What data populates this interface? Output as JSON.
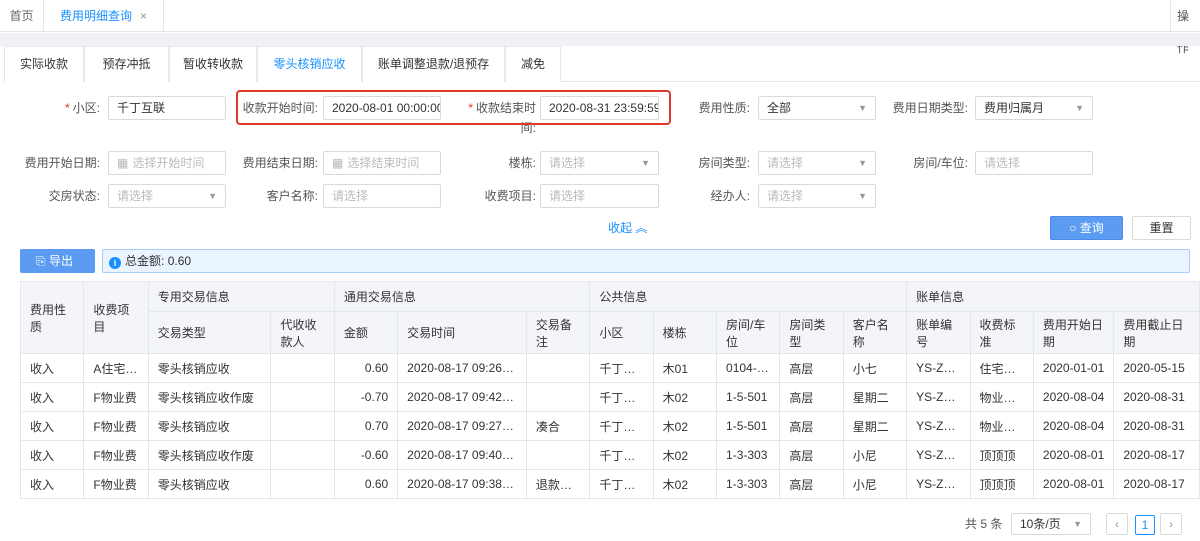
{
  "top_tabs": {
    "home": "首页",
    "active": "费用明细查询",
    "close": "×",
    "ops": "操作"
  },
  "sub_tabs": [
    "实际收款",
    "预存冲抵",
    "暂收转收款",
    "零头核销应收",
    "账单调整退款/退预存",
    "减免"
  ],
  "filters": {
    "community_label": "小区:",
    "community_value": "千丁互联",
    "pay_start_label": "收款开始时间:",
    "pay_start_value": "2020-08-01 00:00:00",
    "pay_end_label": "收款结束时",
    "pay_end_label2": "间:",
    "pay_end_value": "2020-08-31 23:59:59",
    "fee_nature_label": "费用性质:",
    "fee_nature_value": "全部",
    "fee_date_type_label": "费用日期类型:",
    "fee_date_type_value": "费用归属月",
    "fee_start_label": "费用开始日期:",
    "fee_start_placeholder": "选择开始时间",
    "fee_end_label": "费用结束日期:",
    "fee_end_placeholder": "选择结束时间",
    "building_label": "楼栋:",
    "building_placeholder": "请选择",
    "room_type_label": "房间类型:",
    "room_type_placeholder": "请选择",
    "room_label": "房间/车位:",
    "room_placeholder": "请选择",
    "handover_label": "交房状态:",
    "handover_placeholder": "请选择",
    "customer_label": "客户名称:",
    "customer_placeholder": "请选择",
    "item_label": "收费项目:",
    "item_placeholder": "请选择",
    "operator_label": "经办人:",
    "operator_placeholder": "请选择"
  },
  "actions": {
    "collapse": "收起",
    "query": "查询",
    "reset": "重置",
    "export": "导出"
  },
  "summary": {
    "label": "总金额:",
    "value": "0.60"
  },
  "table": {
    "group_headers": {
      "special": "专用交易信息",
      "general": "通用交易信息",
      "public": "公共信息",
      "bill": "账单信息"
    },
    "col_nature": "费用性质",
    "col_item": "收费项目",
    "sub_headers": [
      "交易类型",
      "代收收款人",
      "金额",
      "交易时间",
      "交易备注",
      "小区",
      "楼栋",
      "房间/车位",
      "房间类型",
      "客户名称",
      "账单编号",
      "收费标准",
      "费用开始日期",
      "费用截止日期"
    ],
    "rows": [
      [
        "收入",
        "A住宅…",
        "零头核销应收",
        "",
        "0.60",
        "2020-08-17 09:26:…",
        "",
        "千丁…",
        "木01",
        "0104-…",
        "高层",
        "小七",
        "YS-ZC…",
        "住宅…",
        "2020-01-01",
        "2020-05-15"
      ],
      [
        "收入",
        "F物业费",
        "零头核销应收作废",
        "",
        "-0.70",
        "2020-08-17 09:42:…",
        "",
        "千丁…",
        "木02",
        "1-5-501",
        "高层",
        "星期二",
        "YS-ZC…",
        "物业…",
        "2020-08-04",
        "2020-08-31"
      ],
      [
        "收入",
        "F物业费",
        "零头核销应收",
        "",
        "0.70",
        "2020-08-17 09:27:…",
        "凑合",
        "千丁…",
        "木02",
        "1-5-501",
        "高层",
        "星期二",
        "YS-ZC…",
        "物业…",
        "2020-08-04",
        "2020-08-31"
      ],
      [
        "收入",
        "F物业费",
        "零头核销应收作废",
        "",
        "-0.60",
        "2020-08-17 09:40:…",
        "",
        "千丁…",
        "木02",
        "1-3-303",
        "高层",
        "小尼",
        "YS-ZC…",
        "顶顶顶",
        "2020-08-01",
        "2020-08-17"
      ],
      [
        "收入",
        "F物业费",
        "零头核销应收",
        "",
        "0.60",
        "2020-08-17 09:38:…",
        "退款…",
        "千丁…",
        "木02",
        "1-3-303",
        "高层",
        "小尼",
        "YS-ZC…",
        "顶顶顶",
        "2020-08-01",
        "2020-08-17"
      ]
    ]
  },
  "pagination": {
    "total": "共 5 条",
    "page_size": "10条/页",
    "current": "1",
    "prev": "‹",
    "next": "›"
  }
}
